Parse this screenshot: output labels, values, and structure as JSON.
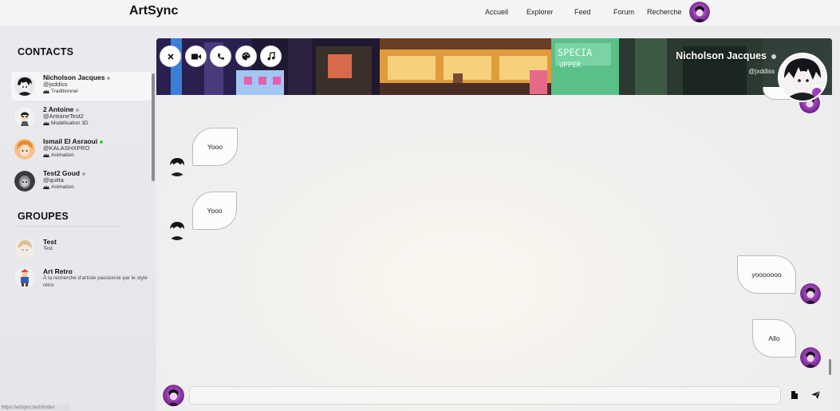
{
  "app": {
    "brand": "ArtSync"
  },
  "nav": {
    "links": [
      {
        "label": "Accueil"
      },
      {
        "label": "Explorer"
      },
      {
        "label": "Feed"
      },
      {
        "label": "Forum"
      },
      {
        "label": "Recherche"
      }
    ],
    "avatar_icon": "user-avatar-icon"
  },
  "sidebar": {
    "contacts_title": "CONTACTS",
    "groups_title": "GROUPES",
    "contacts": [
      {
        "name": "Nicholson Jacques",
        "handle": "@jxddiss",
        "specialty": "Traditionnel",
        "online": false,
        "active": true
      },
      {
        "name": "2 Antoine",
        "handle": "@AntoineTest2",
        "specialty": "Modélisation 3D",
        "online": false,
        "active": false
      },
      {
        "name": "Ismail El Asraoui",
        "handle": "@KALASHXPRO",
        "specialty": "Animation",
        "online": true,
        "active": false
      },
      {
        "name": "Test2 Goud",
        "handle": "@quitta",
        "specialty": "Animation",
        "online": false,
        "active": false
      }
    ],
    "groups": [
      {
        "name": "Test",
        "description": "Test"
      },
      {
        "name": "Art Retro",
        "description": "À la recherche d'artiste passionné par le style rétro"
      }
    ]
  },
  "chat": {
    "header": {
      "name": "Nicholson Jacques",
      "handle": "@jxddiss",
      "online": false
    },
    "controls": [
      {
        "icon": "close-icon"
      },
      {
        "icon": "video-camera-icon"
      },
      {
        "icon": "phone-icon"
      },
      {
        "icon": "palette-icon"
      },
      {
        "icon": "music-note-icon"
      }
    ],
    "messages": [
      {
        "text": "Yooo",
        "from": "other"
      },
      {
        "text": "Yooo",
        "from": "other"
      },
      {
        "text": "yooooooo",
        "from": "me"
      },
      {
        "text": "Allo",
        "from": "me"
      }
    ],
    "composer": {
      "placeholder": "",
      "attach_icon": "file-icon",
      "send_icon": "paper-plane-icon"
    }
  },
  "status_bar": {
    "url": "https://artsync.tech/index"
  },
  "colors": {
    "online": "#3cc84a",
    "offline": "#aaaaaa",
    "accent_purple": "#8a2fa8"
  }
}
